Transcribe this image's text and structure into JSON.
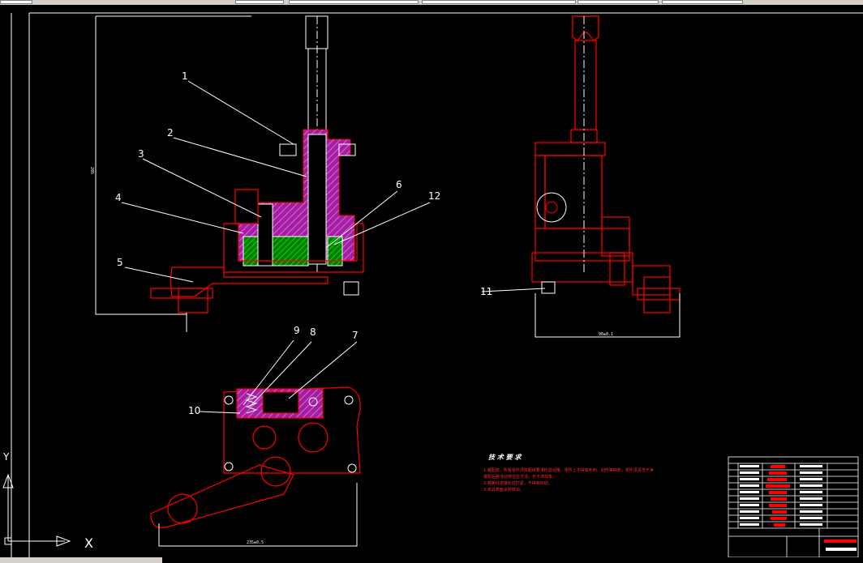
{
  "callouts": [
    "1",
    "2",
    "3",
    "4",
    "5",
    "6",
    "12",
    "7",
    "8",
    "9",
    "10",
    "11"
  ],
  "dimensions": {
    "front_height": "205",
    "side_width": "90±0.1",
    "plan_width": "235±0.5"
  },
  "tech_requirements": {
    "title": "技 术 要 求",
    "items": [
      "1.装配前，所有零件须按图纸要求检验合格，零件上不得有毛刺、划伤等缺陷，零件须清洗干净",
      "装配后各活动部位应灵活，无卡滞现象。",
      "2.各螺纹连接处应拧紧，不得有松动。",
      "3.夹具表面涂防锈油。"
    ]
  },
  "ucs": {
    "x_label": "X",
    "y_label": "Y"
  },
  "colors": {
    "red": "#ff0000",
    "white": "#ffffff",
    "magenta": "#d040d0",
    "green": "#00b000"
  }
}
